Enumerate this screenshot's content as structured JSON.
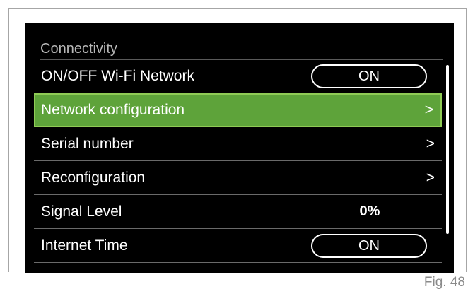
{
  "screen": {
    "header": "Connectivity",
    "rows": [
      {
        "label": "ON/OFF Wi-Fi Network",
        "toggle": "ON"
      },
      {
        "label": "Network configuration",
        "arrow": ">"
      },
      {
        "label": "Serial number",
        "arrow": ">"
      },
      {
        "label": "Reconfiguration",
        "arrow": ">"
      },
      {
        "label": "Signal Level",
        "value": "0%"
      },
      {
        "label": "Internet Time",
        "toggle": "ON"
      }
    ]
  },
  "caption": "Fig. 48",
  "colors": {
    "selected_bg": "#5ea33a",
    "selected_border": "#8fcb55",
    "screen_bg": "#000000"
  }
}
